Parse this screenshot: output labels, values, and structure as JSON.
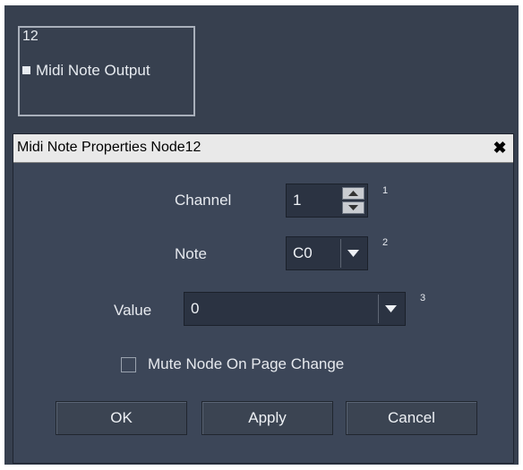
{
  "node": {
    "id": "12",
    "label": "Midi Note Output"
  },
  "dialog": {
    "title": "Midi Note Properties Node12",
    "close_glyph": "✖",
    "channel": {
      "label": "Channel",
      "value": "1",
      "sup": "1"
    },
    "note": {
      "label": "Note",
      "value": "C0",
      "sup": "2"
    },
    "value": {
      "label": "Value",
      "value": "0",
      "sup": "3"
    },
    "mute": {
      "label": "Mute Node On Page Change",
      "checked": false
    },
    "buttons": {
      "ok": "OK",
      "apply": "Apply",
      "cancel": "Cancel"
    }
  }
}
